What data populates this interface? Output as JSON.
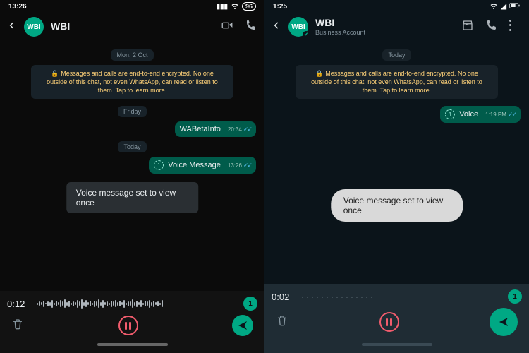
{
  "left": {
    "status": {
      "time": "13:26",
      "battery": "96"
    },
    "header": {
      "avatar_text": "WBI",
      "title": "WBI"
    },
    "dates": {
      "d1": "Mon, 2 Oct",
      "d2": "Friday",
      "d3": "Today"
    },
    "e2e": "Messages and calls are end-to-end encrypted. No one outside of this chat, not even WhatsApp, can read or listen to them. Tap to learn more.",
    "msg1": {
      "text": "WABetaInfo",
      "time": "20:34"
    },
    "msg2": {
      "text": "Voice Message",
      "time": "13:26"
    },
    "toast": "Voice message set to view once",
    "recorder": {
      "time": "0:12",
      "once": "1"
    }
  },
  "right": {
    "status": {
      "time": "1:25"
    },
    "header": {
      "avatar_text": "WBI",
      "title": "WBI",
      "subtitle": "Business Account"
    },
    "dates": {
      "d1": "Today"
    },
    "e2e": "Messages and calls are end-to-end encrypted. No one outside of this chat, not even WhatsApp, can read or listen to them. Tap to learn more.",
    "msg1": {
      "text": "Voice",
      "time": "1:19 PM"
    },
    "toast": "Voice message set to view once",
    "recorder": {
      "time": "0:02",
      "once": "1"
    }
  }
}
